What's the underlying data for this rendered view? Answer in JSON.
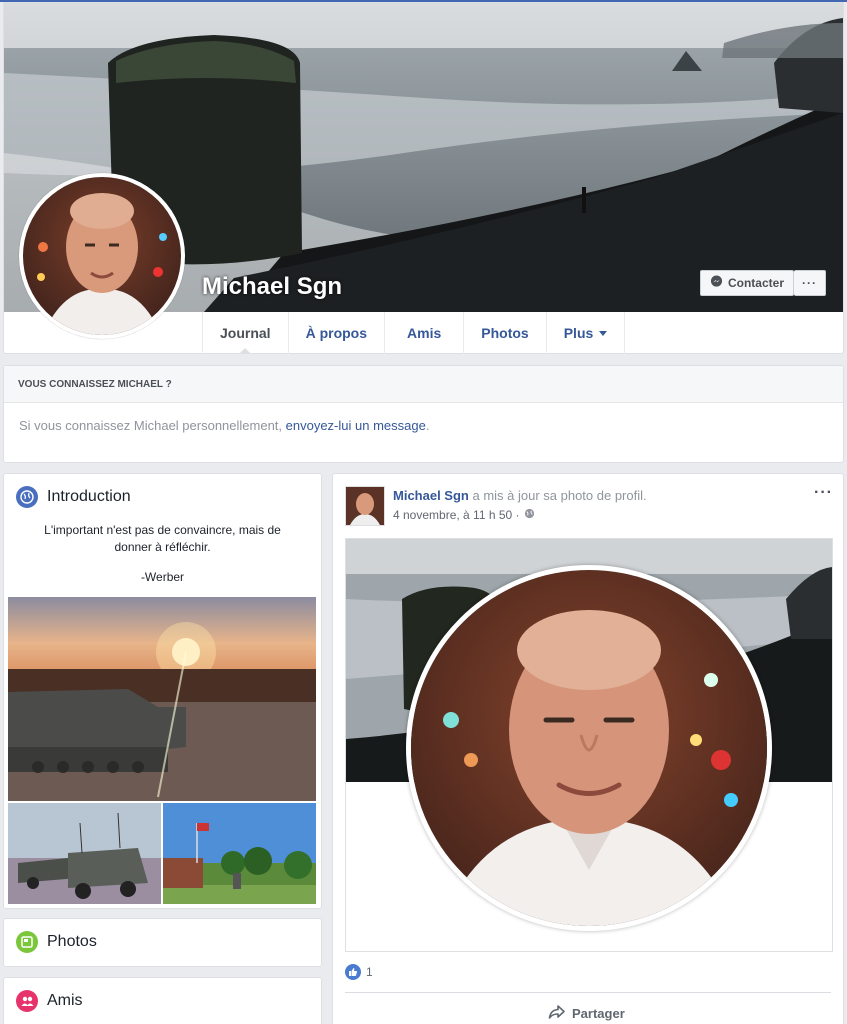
{
  "profile": {
    "name": "Michael Sgn",
    "contact_label": "Contacter",
    "more_label": "···",
    "tabs": [
      "Journal",
      "À propos",
      "Amis",
      "Photos",
      "Plus"
    ]
  },
  "know": {
    "heading": "VOUS CONNAISSEZ MICHAEL ?",
    "text_before": "Si vous connaissez Michael personnellement, ",
    "link": "envoyez-lui un message",
    "text_after": "."
  },
  "intro": {
    "title": "Introduction",
    "quote": "L'important n'est pas de convaincre, mais de donner à réfléchir.",
    "author": "-Werber"
  },
  "photos_section": {
    "title": "Photos"
  },
  "friends_section": {
    "title": "Amis"
  },
  "post": {
    "author": "Michael Sgn",
    "action": " a mis à jour sa photo de profil.",
    "date": "4 novembre, à 11 h 50 ·",
    "more_label": "···",
    "likes_count": "1",
    "share_label": "Partager"
  },
  "colors": {
    "brand_blue": "#4267b2",
    "link": "#365899",
    "background": "#e9ebee",
    "intro_icon": "#4a6fbf",
    "photos_icon": "#7cc63c",
    "friends_icon": "#e6336b"
  },
  "icons": [
    "messenger-icon",
    "globe-icon",
    "photo-icon",
    "friends-icon",
    "like-icon",
    "share-icon",
    "public-icon",
    "dropdown-caret-icon"
  ]
}
